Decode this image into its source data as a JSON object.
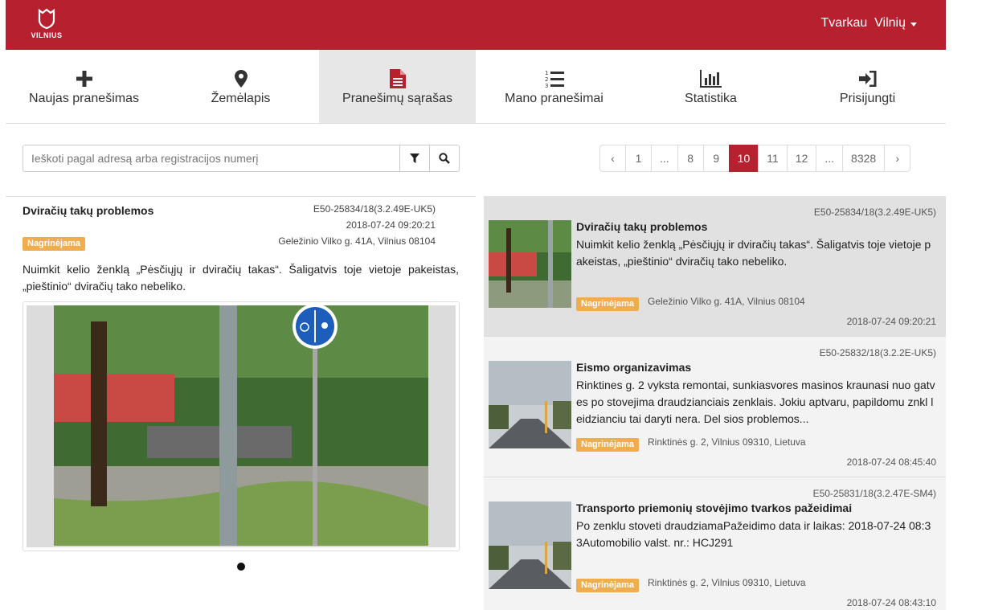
{
  "header": {
    "logo_text": "VILNIUS",
    "user_menu_label": "Tvarkau  Vilnių"
  },
  "nav": {
    "items": [
      {
        "label": "Naujas pranešimas",
        "icon": "plus-icon"
      },
      {
        "label": "Žemėlapis",
        "icon": "map-marker-icon"
      },
      {
        "label": "Pranešimų sąrašas",
        "icon": "file-text-icon"
      },
      {
        "label": "Mano pranešimai",
        "icon": "ordered-list-icon"
      },
      {
        "label": "Statistika",
        "icon": "bar-chart-icon"
      },
      {
        "label": "Prisijungti",
        "icon": "sign-in-icon"
      }
    ],
    "active_index": 2
  },
  "search": {
    "placeholder": "Ieškoti pagal adresą arba registracijos numerį",
    "value": ""
  },
  "pagination": {
    "prev": "‹",
    "next": "›",
    "pages": [
      "1",
      "...",
      "8",
      "9",
      "10",
      "11",
      "12",
      "...",
      "8328"
    ],
    "active": "10"
  },
  "detail": {
    "title": "Dviračių takų problemos",
    "code": "E50-25834/18(3.2.49E-UK5)",
    "date": "2018-07-24 09:20:21",
    "status": "Nagrinėjama",
    "address": "Geležinio Vilko g. 41A, Vilnius 08104",
    "text": "Nuimkit kelio ženklą „Pėsčiųjų ir dviračių takas“. Šaligatvis toje vietoje pakeistas, „pieštinio“ dviračių tako nebeliko."
  },
  "list": [
    {
      "code": "E50-25834/18(3.2.49E-UK5)",
      "title": "Dviračių takų problemos",
      "text": "Nuimkit kelio ženklą „Pėsčiųjų ir dviračių takas“. Šaligatvis toje vietoje pakeistas, „pieštinio“ dviračių tako nebeliko.",
      "status": "Nagrinėjama",
      "address": "Geležinio Vilko g. 41A, Vilnius 08104",
      "date": "2018-07-24 09:20:21"
    },
    {
      "code": "E50-25832/18(3.2.2E-UK5)",
      "title": "Eismo organizavimas",
      "text": "Rinktines g. 2 vyksta remontai, sunkiasvores masinos kraunasi nuo gatves po stovejima draudzianciais zenklais. Jokiu aptvaru, papildomu znkl leidzianciu tai daryti nera. Del sios problemos...",
      "status": "Nagrinėjama",
      "address": "Rinktinės g. 2, Vilnius 09310, Lietuva",
      "date": "2018-07-24 08:45:40"
    },
    {
      "code": "E50-25831/18(3.2.47E-SM4)",
      "title": "Transporto priemonių stovėjimo tvarkos pažeidimai",
      "text": "Po zenklu stoveti draudziamaPažeidimo data ir laikas: 2018-07-24 08:33Automobilio valst. nr.: HCJ291",
      "status": "Nagrinėjama",
      "address": "Rinktinės g. 2, Vilnius 09310, Lietuva",
      "date": "2018-07-24 08:43:10"
    }
  ],
  "colors": {
    "brand": "#b7202e",
    "status_badge": "#f0ad4e"
  }
}
